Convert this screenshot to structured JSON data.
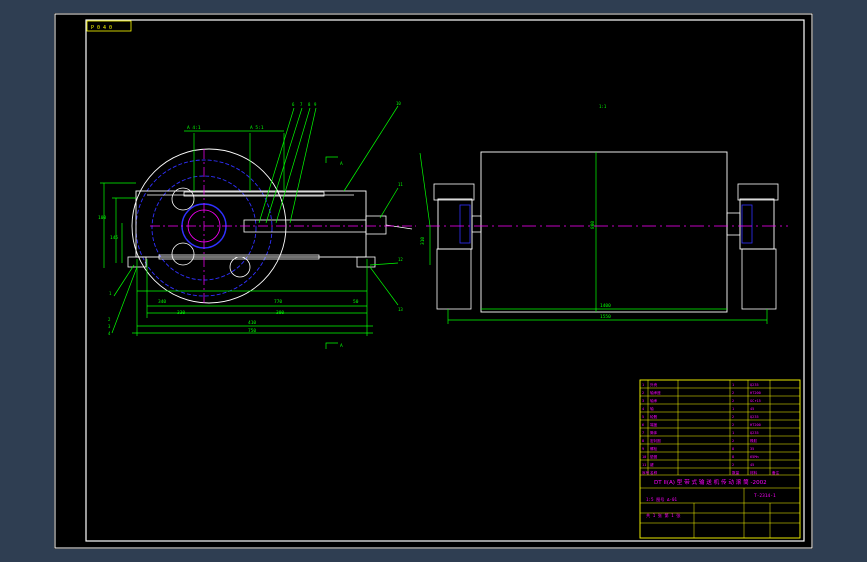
{
  "app": {
    "title_box": "P 0 4 0",
    "colors": {
      "frame": "#ffffff",
      "dim": "#00ff00",
      "center": "#ff00ff",
      "hidden": "#0000ff",
      "title": "#ffff00",
      "tb_text": "#ff00ff"
    }
  },
  "drawing": {
    "section_mark": "A",
    "right_label": "1:1"
  },
  "dims": {
    "front": {
      "d1": "340",
      "d2": "770",
      "d3": "330",
      "d4": "300",
      "d5": "410",
      "d6": "750",
      "d7": "110",
      "d8": "210",
      "d9": "610",
      "d10": "50",
      "top_left": "A 4:1",
      "top_right": "A 5:1",
      "h1": "100",
      "h2": "145"
    },
    "side": {
      "len1": "1400",
      "len2": "1550",
      "dia": "800",
      "left_h": "310"
    }
  },
  "balloons": [
    "6",
    "7",
    "8",
    "9",
    "10",
    "11",
    "12",
    "13",
    "1",
    "2",
    "3",
    "4",
    "5"
  ],
  "title_block": {
    "main_title": "DT II(A) 型 带 式 输 送 机 传 动 滚 筒 -2002",
    "drawing_no": "T-2314-1",
    "scale_row": "1:5  图号 Δ-01",
    "sheet_row": "共 1 张  第 1 张",
    "rows": [
      [
        "1",
        "外壳",
        "1",
        "Q235",
        ""
      ],
      [
        "2",
        "轴承座",
        "2",
        "HT200",
        ""
      ],
      [
        "3",
        "轴承",
        "2",
        "GCr15",
        ""
      ],
      [
        "4",
        "轴",
        "1",
        "45",
        ""
      ],
      [
        "5",
        "轮毂",
        "2",
        "Q235",
        ""
      ],
      [
        "6",
        "端盖",
        "2",
        "HT200",
        ""
      ],
      [
        "7",
        "筒体",
        "1",
        "Q235",
        ""
      ],
      [
        "8",
        "密封圈",
        "2",
        "橡胶",
        ""
      ],
      [
        "9",
        "螺栓",
        "8",
        "35",
        ""
      ],
      [
        "10",
        "垫圈",
        "8",
        "65Mn",
        ""
      ],
      [
        "11",
        "键",
        "2",
        "45",
        ""
      ]
    ],
    "header": [
      "序号",
      "名称",
      "数量",
      "材料",
      "备注"
    ]
  }
}
